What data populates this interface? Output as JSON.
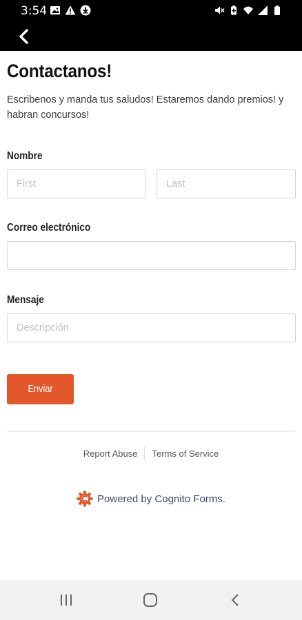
{
  "status_bar": {
    "time": "3:54",
    "left_icons": [
      "image-icon",
      "warning-icon",
      "download-icon"
    ],
    "right_icons": [
      "mute-icon",
      "battery-saver-icon",
      "wifi-icon",
      "signal-icon",
      "battery-icon"
    ]
  },
  "app_bar": {
    "back_icon": "chevron-left-icon"
  },
  "form": {
    "title": "Contactanos!",
    "description": "Escribenos y manda tus saludos! Estaremos dando premios! y habran concursos!",
    "name_label": "Nombre",
    "first_placeholder": "First",
    "first_value": "",
    "last_placeholder": "Last",
    "last_value": "",
    "email_label": "Correo electrónico",
    "email_placeholder": "",
    "email_value": "",
    "message_label": "Mensaje",
    "message_placeholder": "Descripción",
    "message_value": "",
    "submit_label": "Enviar",
    "accent_color": "#e2582a"
  },
  "footer": {
    "report_abuse": "Report Abuse",
    "terms": "Terms of Service",
    "powered_by": "Powered by Cognito Forms.",
    "logo_icon": "cognito-cog-icon"
  },
  "nav_bar": {
    "recents_icon": "recents-icon",
    "home_icon": "home-icon",
    "back_icon": "back-icon"
  }
}
